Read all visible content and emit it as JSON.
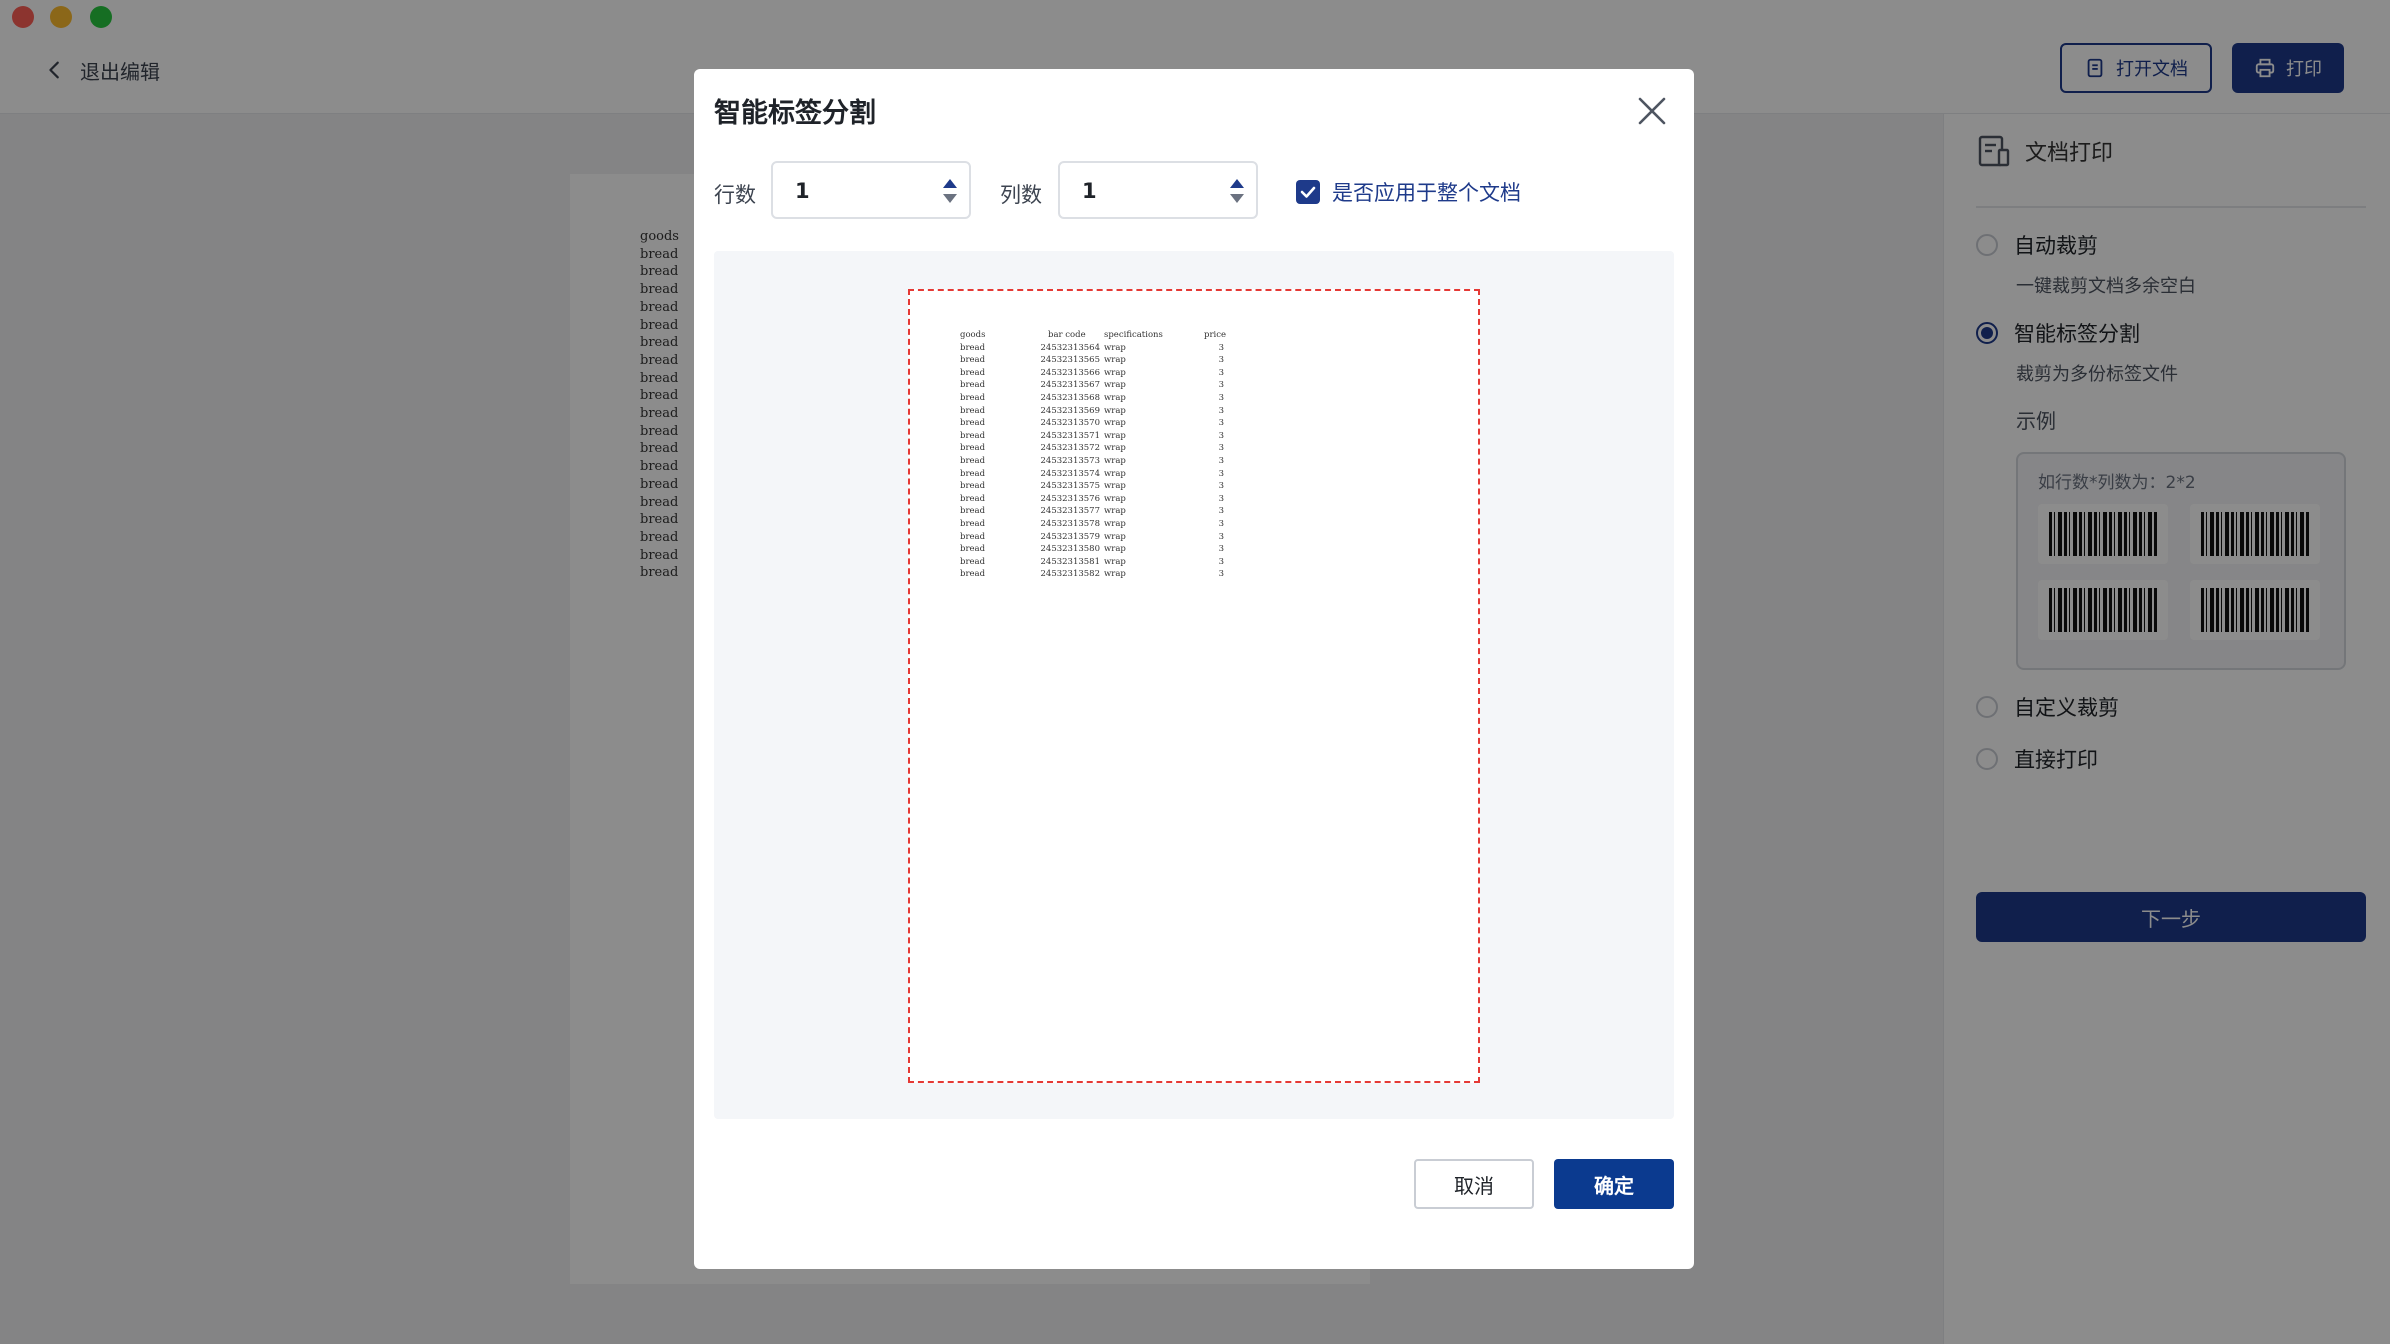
{
  "header": {
    "back_label": "退出编辑",
    "open_doc_label": "打开文档",
    "print_label": "打印"
  },
  "document": {
    "lines": [
      "goods",
      "bread",
      "bread",
      "bread",
      "bread",
      "bread",
      "bread",
      "bread",
      "bread",
      "bread",
      "bread",
      "bread",
      "bread",
      "bread",
      "bread",
      "bread",
      "bread",
      "bread",
      "bread",
      "bread"
    ]
  },
  "sidebar": {
    "title": "文档打印",
    "options": [
      {
        "label": "自动裁剪",
        "desc": "一键裁剪文档多余空白",
        "selected": false
      },
      {
        "label": "智能标签分割",
        "desc": "裁剪为多份标签文件",
        "selected": true
      },
      {
        "label": "自定义裁剪",
        "selected": false
      },
      {
        "label": "直接打印",
        "selected": false
      }
    ],
    "example_label": "示例",
    "example_note": "如行数*列数为：2*2",
    "next_label": "下一步"
  },
  "modal": {
    "title": "智能标签分割",
    "rows_label": "行数",
    "rows_value": "1",
    "cols_label": "列数",
    "cols_value": "1",
    "apply_all_label": "是否应用于整个文档",
    "apply_all_checked": true,
    "preview": {
      "headers": [
        "goods",
        "bar code",
        "specifications",
        "price"
      ],
      "rows": [
        [
          "bread",
          "24532313564",
          "wrap",
          "3"
        ],
        [
          "bread",
          "24532313565",
          "wrap",
          "3"
        ],
        [
          "bread",
          "24532313566",
          "wrap",
          "3"
        ],
        [
          "bread",
          "24532313567",
          "wrap",
          "3"
        ],
        [
          "bread",
          "24532313568",
          "wrap",
          "3"
        ],
        [
          "bread",
          "24532313569",
          "wrap",
          "3"
        ],
        [
          "bread",
          "24532313570",
          "wrap",
          "3"
        ],
        [
          "bread",
          "24532313571",
          "wrap",
          "3"
        ],
        [
          "bread",
          "24532313572",
          "wrap",
          "3"
        ],
        [
          "bread",
          "24532313573",
          "wrap",
          "3"
        ],
        [
          "bread",
          "24532313574",
          "wrap",
          "3"
        ],
        [
          "bread",
          "24532313575",
          "wrap",
          "3"
        ],
        [
          "bread",
          "24532313576",
          "wrap",
          "3"
        ],
        [
          "bread",
          "24532313577",
          "wrap",
          "3"
        ],
        [
          "bread",
          "24532313578",
          "wrap",
          "3"
        ],
        [
          "bread",
          "24532313579",
          "wrap",
          "3"
        ],
        [
          "bread",
          "24532313580",
          "wrap",
          "3"
        ],
        [
          "bread",
          "24532313581",
          "wrap",
          "3"
        ],
        [
          "bread",
          "24532313582",
          "wrap",
          "3"
        ]
      ]
    },
    "cancel_label": "取消",
    "ok_label": "确定"
  },
  "colors": {
    "accent": "#1e3a8a",
    "preview_border": "#e53935"
  }
}
